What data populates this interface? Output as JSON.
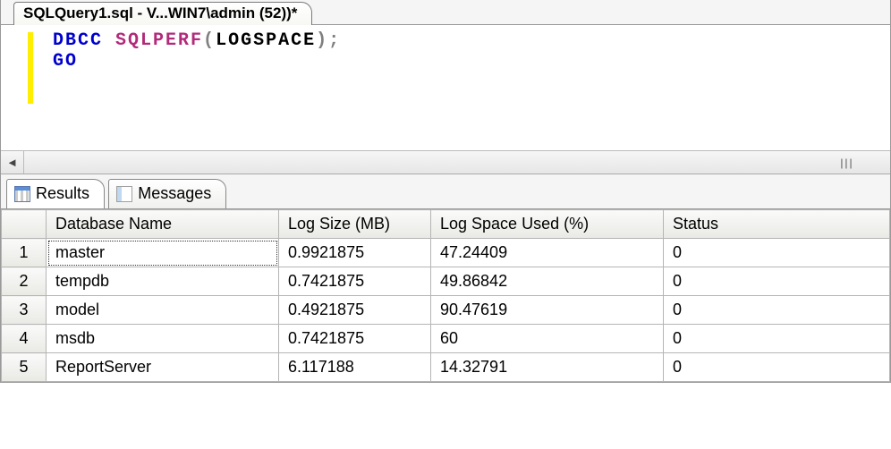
{
  "tab": {
    "title": "SQLQuery1.sql - V...WIN7\\admin (52))*"
  },
  "editor": {
    "kw1": "DBCC",
    "fn": "SQLPERF",
    "arg_open": "(",
    "arg": "LOGSPACE",
    "arg_close": ")",
    "semi": ";",
    "kw2": "GO"
  },
  "scrollbar": {
    "left_arrow": "◄",
    "grip": "|||"
  },
  "result_tabs": {
    "results": "Results",
    "messages": "Messages"
  },
  "grid": {
    "headers": {
      "dbname": "Database Name",
      "logsize": "Log Size (MB)",
      "logused": "Log Space Used (%)",
      "status": "Status"
    },
    "rows": [
      {
        "n": "1",
        "db": "master",
        "size": "0.9921875",
        "used": "47.24409",
        "status": "0",
        "selected": true
      },
      {
        "n": "2",
        "db": "tempdb",
        "size": "0.7421875",
        "used": "49.86842",
        "status": "0"
      },
      {
        "n": "3",
        "db": "model",
        "size": "0.4921875",
        "used": "90.47619",
        "status": "0"
      },
      {
        "n": "4",
        "db": "msdb",
        "size": "0.7421875",
        "used": "60",
        "status": "0"
      },
      {
        "n": "5",
        "db": "ReportServer",
        "size": "6.117188",
        "used": "14.32791",
        "status": "0"
      }
    ]
  }
}
